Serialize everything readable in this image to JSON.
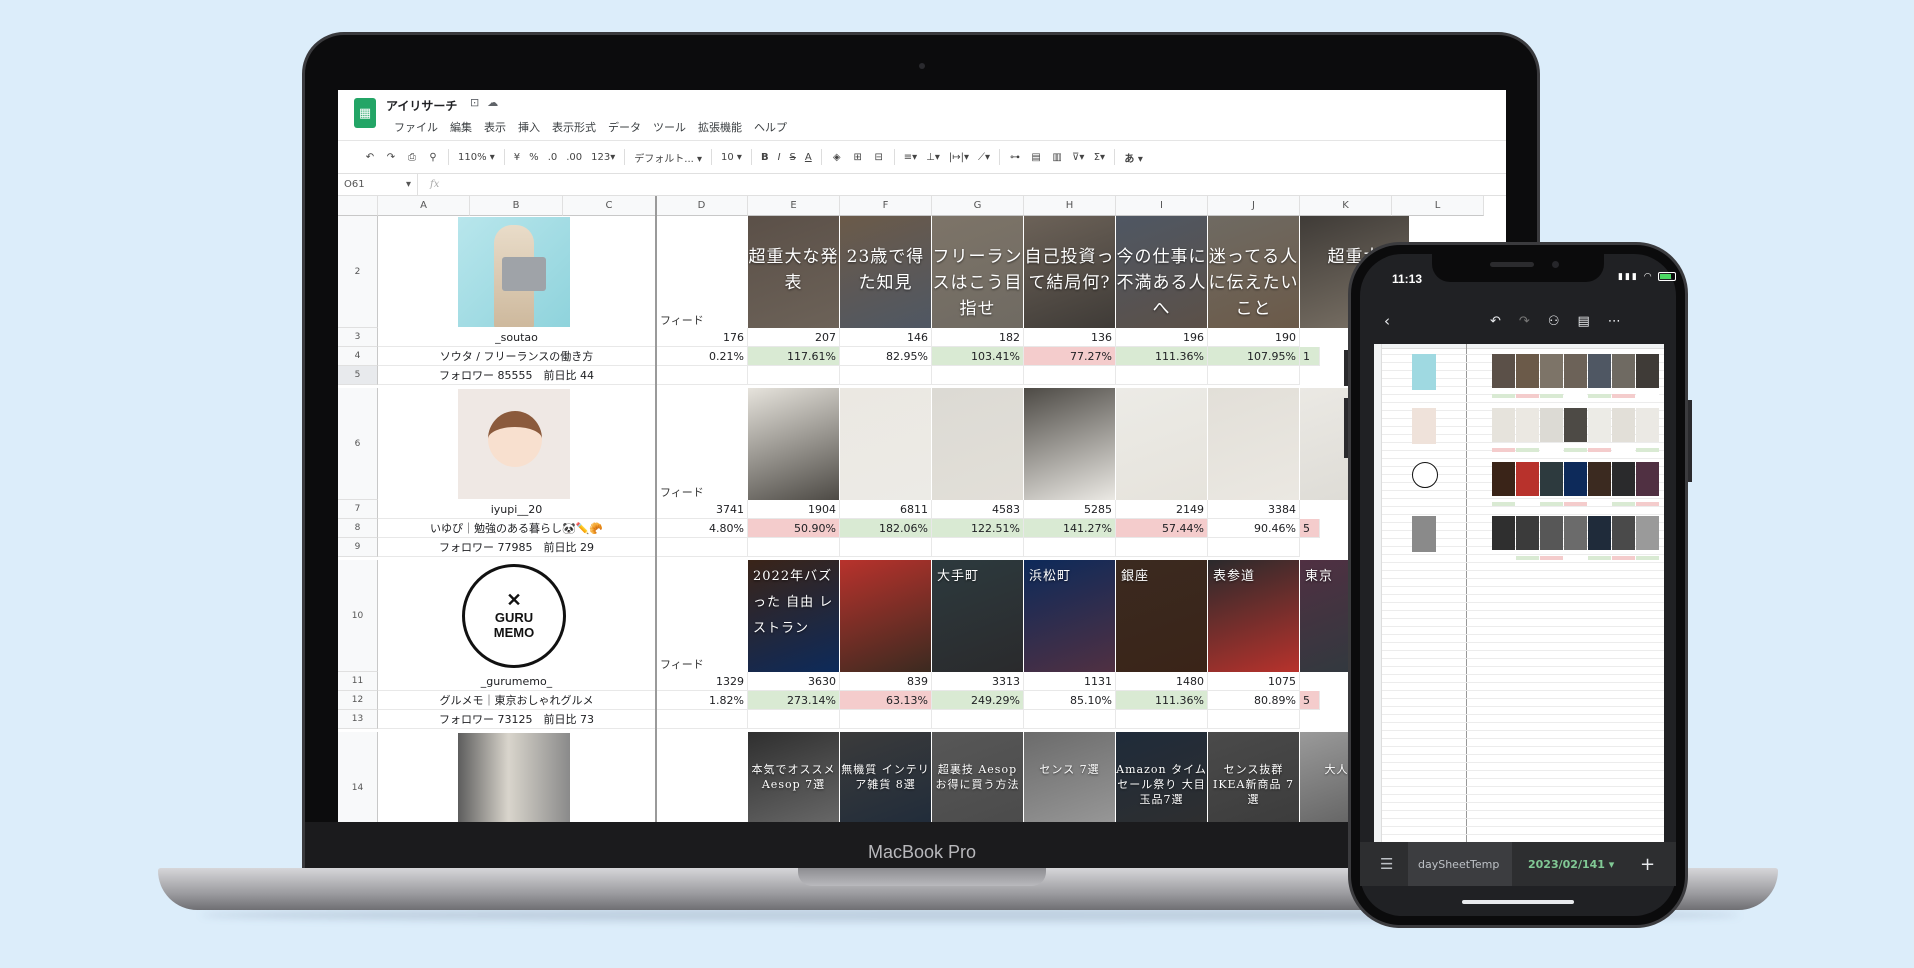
{
  "sheet": {
    "title": "アイリサーチ",
    "menu": [
      "ファイル",
      "編集",
      "表示",
      "挿入",
      "表示形式",
      "データ",
      "ツール",
      "拡張機能",
      "ヘルプ"
    ],
    "toolbar": {
      "zoom": "110%",
      "currency": "¥",
      "percent": "%",
      "decimal_less": ".0",
      "decimal_more": ".00",
      "format_more": "123",
      "font": "デフォルト...",
      "font_size": "10",
      "bold": "B",
      "italic": "I",
      "strike": "S",
      "text_color": "A",
      "input_tool": "あ"
    },
    "name_box": "O61",
    "fx": "fx",
    "columns": [
      "A",
      "B",
      "C",
      "D",
      "E",
      "F",
      "G",
      "H",
      "I",
      "J",
      "K",
      "L"
    ],
    "feed_label": "フィード",
    "accounts": [
      {
        "rows": [
          "2",
          "3",
          "4",
          "5"
        ],
        "handle": "_soutao",
        "name": "ソウタ / フリーランスの働き方",
        "followers": "フォロワー 85555　前日比 44",
        "d_value": "176",
        "d_rate": "0.21%",
        "values": [
          "207",
          "146",
          "182",
          "136",
          "196",
          "190"
        ],
        "rates": [
          "117.61%",
          "82.95%",
          "103.41%",
          "77.27%",
          "111.36%",
          "107.95%"
        ],
        "rate_colors": [
          "green",
          "",
          "green",
          "red",
          "green",
          "green"
        ],
        "captions": [
          "超重大な発表",
          "23歳で得た知見",
          "フリーランスはこう目指せ",
          "自己投資って結局何?",
          "今の仕事に不満ある人へ",
          "迷ってる人に伝えたいこと",
          "超重大"
        ]
      },
      {
        "rows": [
          "6",
          "7",
          "8",
          "9"
        ],
        "handle": "iyupi__20",
        "name": "いゆぴ︎︎︎︎︎︎︎︎︎︎︎︎︎︎︎︎｜勉強のある暮らし🐼✏️🥐",
        "followers": "フォロワー 77985　前日比 29",
        "d_value": "3741",
        "d_rate": "4.80%",
        "values": [
          "1904",
          "6811",
          "4583",
          "5285",
          "2149",
          "3384"
        ],
        "rates": [
          "50.90%",
          "182.06%",
          "122.51%",
          "141.27%",
          "57.44%",
          "90.46%"
        ],
        "rate_colors": [
          "red",
          "green",
          "green",
          "green",
          "red",
          ""
        ],
        "captions": [
          "",
          "",
          "",
          "",
          "",
          "",
          ""
        ]
      },
      {
        "rows": [
          "10",
          "11",
          "12",
          "13"
        ],
        "handle": "_gurumemo_",
        "name": "グルメモ｜東京おしゃれグルメ",
        "followers": "フォロワー 73125　前日比 73",
        "logo_line1": "GURU",
        "logo_line2": "MEMO",
        "d_value": "1329",
        "d_rate": "1.82%",
        "values": [
          "3630",
          "839",
          "3313",
          "1131",
          "1480",
          "1075"
        ],
        "rates": [
          "273.14%",
          "63.13%",
          "249.29%",
          "85.10%",
          "111.36%",
          "80.89%"
        ],
        "rate_colors": [
          "green",
          "red",
          "green",
          "",
          "green",
          ""
        ],
        "captions": [
          "2022年バズった 自由 レストラン",
          "",
          "大手町",
          "浜松町",
          "銀座",
          "表参道",
          "東京"
        ]
      },
      {
        "rows": [
          "14"
        ],
        "captions": [
          "本気でオススメ Aesop 7選",
          "無機質 インテリア雑貨 8選",
          "超裏技 Aesop お得に買う方法",
          "センス 7選",
          "Amazon タイムセール祭り 大目玉品7選",
          "センス抜群 IKEA新商品 7選",
          "大人に人気"
        ]
      }
    ],
    "partial_col_k": [
      "1",
      "5",
      "5"
    ]
  },
  "laptop_label": "MacBook Pro",
  "phone": {
    "time": "11:13",
    "tab_name": "daySheetTemp",
    "tab_date": "2023/02/141",
    "add": "+"
  },
  "colors": {
    "background": "#dcedfa",
    "sheets_green": "#23a566",
    "rate_green": "#d9ead3",
    "rate_red": "#f4cccc"
  }
}
